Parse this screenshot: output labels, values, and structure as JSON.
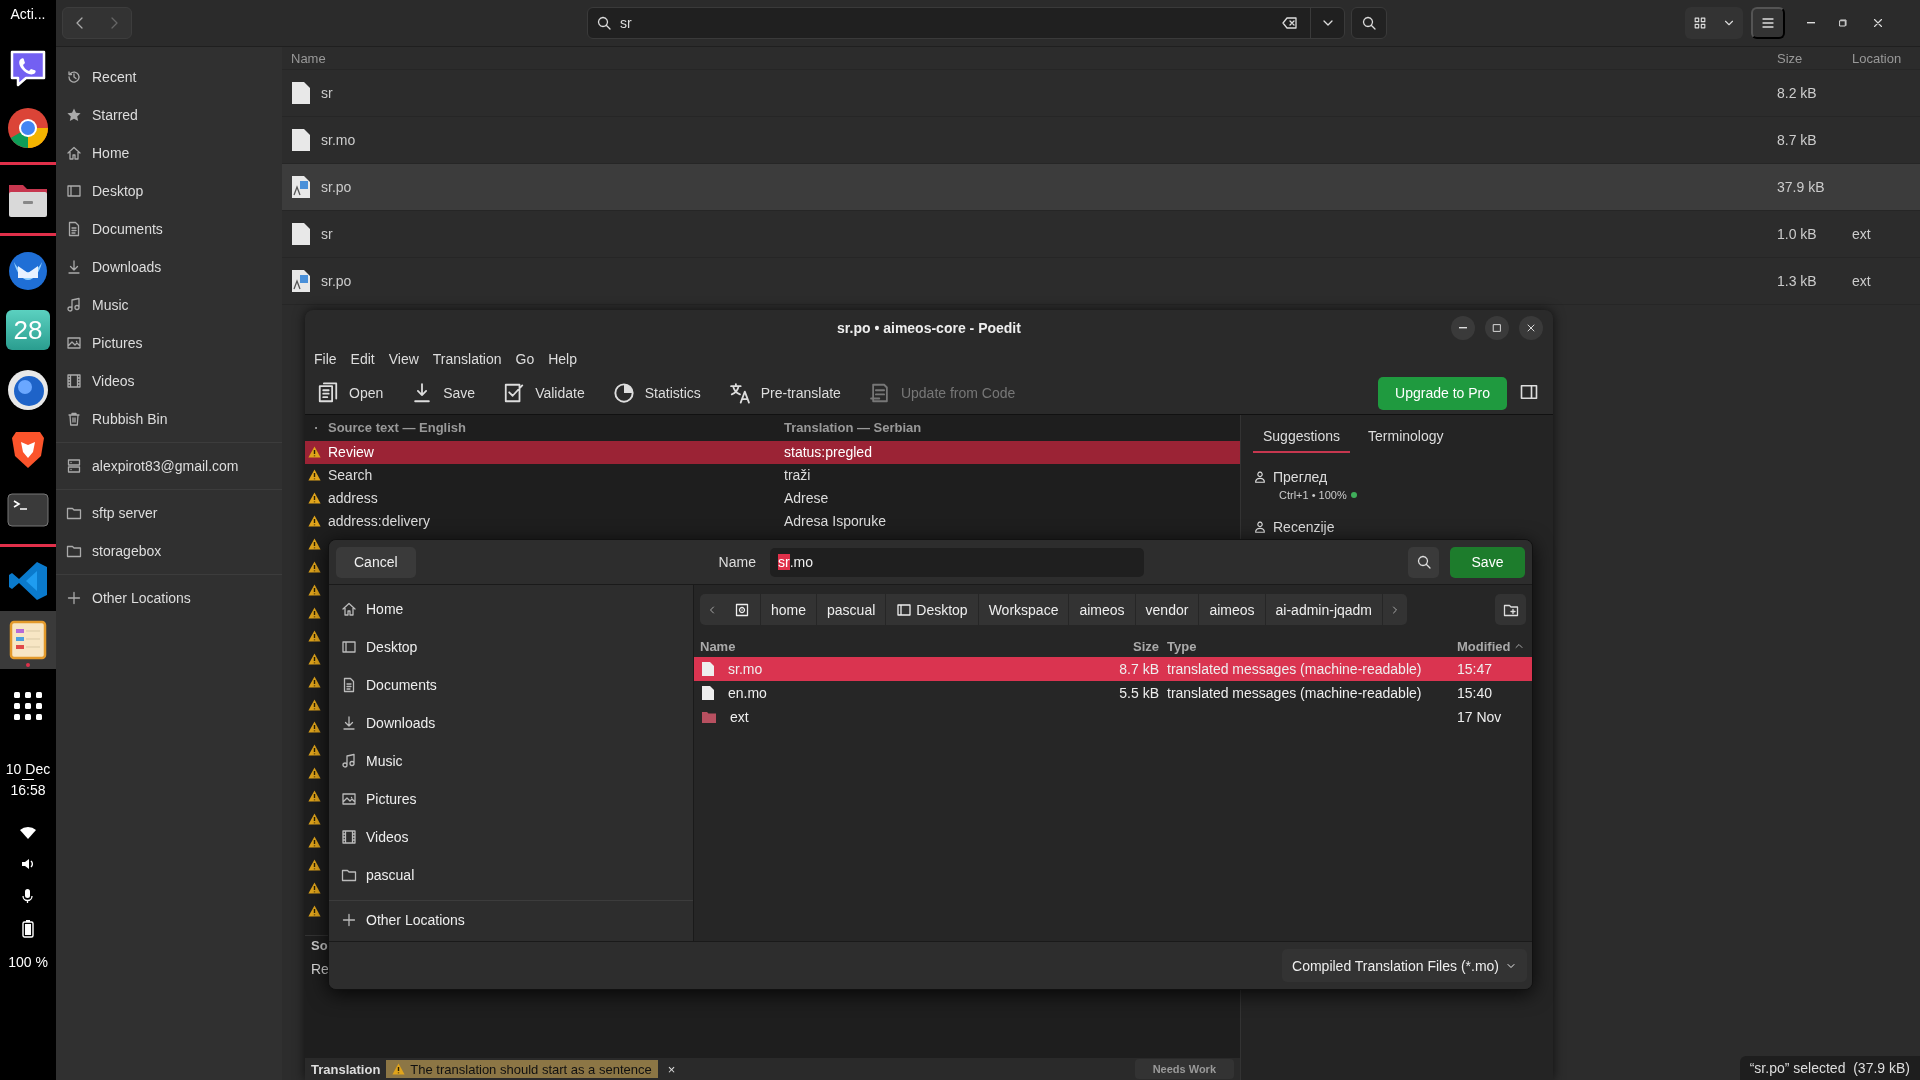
{
  "dock": {
    "activities": "Acti...",
    "apps": [
      {
        "kind": "messenger",
        "active": false
      },
      {
        "kind": "browser",
        "active": false
      },
      {
        "kind": "files",
        "active": false
      },
      {
        "kind": "mail",
        "active": false
      },
      {
        "kind": "calendar",
        "label": "28",
        "active": false
      },
      {
        "kind": "globe",
        "active": false
      },
      {
        "kind": "lion",
        "active": false
      },
      {
        "kind": "terminal",
        "active": false
      },
      {
        "kind": "code",
        "active": false
      },
      {
        "kind": "poedit",
        "active": true
      }
    ],
    "date": "10 Dec",
    "time": "16:58",
    "battery": "100 %"
  },
  "file_manager": {
    "search": {
      "value": "sr"
    },
    "sidebar": {
      "groups": [
        [
          {
            "label": "Recent",
            "kind": "clock"
          },
          {
            "label": "Starred",
            "kind": "star"
          },
          {
            "label": "Home",
            "kind": "home"
          },
          {
            "label": "Desktop",
            "kind": "desktop"
          },
          {
            "label": "Documents",
            "kind": "document"
          },
          {
            "label": "Downloads",
            "kind": "download"
          },
          {
            "label": "Music",
            "kind": "music"
          },
          {
            "label": "Pictures",
            "kind": "picture"
          },
          {
            "label": "Videos",
            "kind": "video"
          },
          {
            "label": "Rubbish Bin",
            "kind": "trash"
          }
        ],
        [
          {
            "label": "alexpirot83@gmail.com",
            "kind": "server"
          }
        ],
        [
          {
            "label": "sftp server",
            "kind": "folder"
          },
          {
            "label": "storagebox",
            "kind": "folder"
          }
        ],
        [
          {
            "label": "Other Locations",
            "kind": "plus"
          }
        ]
      ]
    },
    "columns": [
      "Name",
      "Size",
      "Location"
    ],
    "rows": [
      {
        "name": "sr",
        "kind": "file",
        "size": "8.2 kB",
        "selected": false
      },
      {
        "name": "sr.mo",
        "kind": "file",
        "size": "8.7 kB",
        "selected": false
      },
      {
        "name": "sr.po",
        "kind": "translation",
        "size": "37.9 kB",
        "selected": true
      },
      {
        "name": "sr",
        "kind": "file",
        "size": "1.0 kB",
        "location": "ext",
        "selected": false
      },
      {
        "name": "sr.po",
        "kind": "translation",
        "size": "1.3 kB",
        "location": "ext",
        "selected": false
      }
    ],
    "status": "“sr.po” selected  (37.9 kB)"
  },
  "poedit": {
    "title": "sr.po • aimeos-core - Poedit",
    "menu": [
      "File",
      "Edit",
      "View",
      "Translation",
      "Go",
      "Help"
    ],
    "toolbar": [
      {
        "label": "Open",
        "kind": "open",
        "disabled": false
      },
      {
        "label": "Save",
        "kind": "save",
        "disabled": false
      },
      {
        "label": "Validate",
        "kind": "validate",
        "disabled": false
      },
      {
        "label": "Statistics",
        "kind": "stats",
        "disabled": false
      },
      {
        "label": "Pre-translate",
        "kind": "translate",
        "disabled": false
      },
      {
        "label": "Update from Code",
        "kind": "update",
        "disabled": true
      }
    ],
    "upgrade_button": "Upgrade to Pro",
    "columns": [
      "·",
      "Source text — English",
      "Translation — Serbian"
    ],
    "rows": [
      {
        "source": "Review",
        "translation": "status:pregled",
        "warning": true,
        "selected": true
      },
      {
        "source": "Search",
        "translation": "traži",
        "warning": true,
        "selected": false
      },
      {
        "source": "address",
        "translation": "Adrese",
        "warning": true,
        "selected": false
      },
      {
        "source": "address:delivery",
        "translation": "Adresa Isporuke",
        "warning": true,
        "selected": false
      }
    ],
    "covered_rows": [
      {
        "warning": true
      },
      {
        "warning": true
      },
      {
        "warning": true
      },
      {
        "warning": true
      },
      {
        "warning": true
      },
      {
        "warning": true
      },
      {
        "warning": true
      },
      {
        "warning": true
      },
      {
        "warning": true
      },
      {
        "warning": true
      },
      {
        "warning": true
      },
      {
        "warning": true
      },
      {
        "warning": true
      },
      {
        "warning": true
      },
      {
        "warning": true
      },
      {
        "warning": true
      },
      {
        "warning": true
      }
    ],
    "side_tabs": [
      {
        "label": "Suggestions",
        "selected": true
      },
      {
        "label": "Terminology",
        "selected": false
      }
    ],
    "suggestions": [
      {
        "text": "Преглед",
        "meta": "Ctrl+1 • 100%"
      },
      {
        "text": "Recenzije"
      }
    ],
    "source_pane": {
      "heading": "So",
      "text": "Re"
    },
    "translation_bar": {
      "label": "Translation",
      "warning": "The translation should start as a sentence",
      "close": "×",
      "button": "Needs Work"
    }
  },
  "dialog": {
    "cancel": "Cancel",
    "name_label": "Name",
    "name_field": {
      "selected_text": "sr",
      "text_after": ".mo"
    },
    "save": "Save",
    "sidebar": [
      [
        {
          "label": "Home",
          "kind": "home"
        },
        {
          "label": "Desktop",
          "kind": "desktop"
        },
        {
          "label": "Documents",
          "kind": "document"
        },
        {
          "label": "Downloads",
          "kind": "download"
        },
        {
          "label": "Music",
          "kind": "music"
        },
        {
          "label": "Pictures",
          "kind": "picture"
        },
        {
          "label": "Videos",
          "kind": "video"
        },
        {
          "label": "pascual",
          "kind": "folder"
        }
      ],
      [
        {
          "label": "Other Locations",
          "kind": "plus"
        }
      ]
    ],
    "path": [
      {
        "kind": "disk"
      },
      {
        "label": "home"
      },
      {
        "label": "pascual"
      },
      {
        "label": "Desktop",
        "kind": "desktop"
      },
      {
        "label": "Workspace"
      },
      {
        "label": "aimeos"
      },
      {
        "label": "vendor"
      },
      {
        "label": "aimeos"
      },
      {
        "label": "ai-admin-jqadm"
      }
    ],
    "columns": [
      "Name",
      "Size",
      "Type",
      "Modified"
    ],
    "rows": [
      {
        "name": "sr.mo",
        "kind": "file",
        "size": "8.7 kB",
        "type": "translated messages (machine-readable)",
        "modified": "15:47",
        "selected": true
      },
      {
        "name": "en.mo",
        "kind": "file",
        "size": "5.5 kB",
        "type": "translated messages (machine-readable)",
        "modified": "15:40",
        "selected": false
      },
      {
        "name": "ext",
        "kind": "folder",
        "modified": "17 Nov",
        "selected": false
      }
    ],
    "filter": "Compiled Translation Files (*.mo)"
  }
}
